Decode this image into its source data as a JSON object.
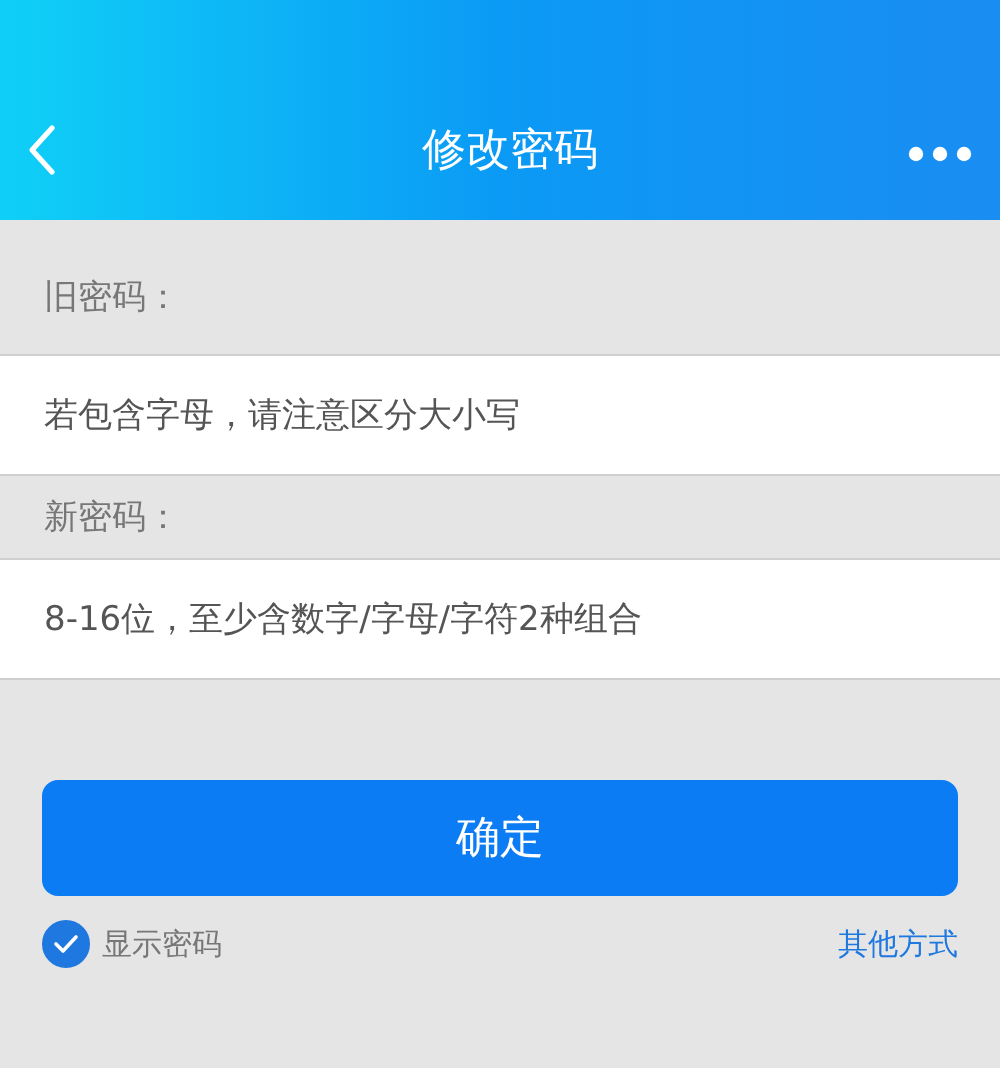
{
  "header": {
    "title": "修改密码"
  },
  "fields": [
    {
      "label": "旧密码：",
      "placeholder": "若包含字母，请注意区分大小写"
    },
    {
      "label": "新密码：",
      "placeholder": "8-16位，至少含数字/字母/字符2种组合"
    }
  ],
  "submit": "确定",
  "show_password": {
    "label": "显示密码",
    "checked": true
  },
  "other_link": "其他方式"
}
